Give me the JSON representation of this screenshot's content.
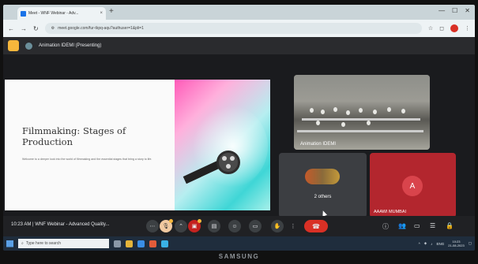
{
  "browser": {
    "tab_title": "Meet - WNF Webinar - Adv...",
    "new_tab": "+",
    "close_tab": "×",
    "url": "meet.google.com/fur-tkpq-aqu?authuser=1&pli=1",
    "window_controls": [
      "—",
      "☐",
      "✕"
    ]
  },
  "meet": {
    "presenting_label": "Animation IDEMI (Presenting)",
    "slide": {
      "title": "Filmmaking: Stages of Production",
      "body": "Welcome to a deeper look into the world of filmmaking and the essential stages that bring a story to life."
    },
    "tiles": {
      "camera_label": "Animation IDEMI",
      "others_label": "2 others",
      "aaawi_avatar": "A",
      "aaawi_label": "AAAWI MUMBAI"
    },
    "bottom_bar": {
      "time": "10:23 AM",
      "separator": "|",
      "meeting_title": "WNF Webinar - Advanced Quality...",
      "end_call_icon": "phone-end-icon"
    }
  },
  "taskbar": {
    "search_placeholder": "Type here to search",
    "tray_lang": "ENG",
    "time": "10:23",
    "date": "21-08-2023"
  },
  "monitor": {
    "brand": "SAMSUNG"
  },
  "colors": {
    "end_call": "#d93025",
    "aaawi_tile": "#b3262e",
    "meet_bg": "#202124"
  }
}
